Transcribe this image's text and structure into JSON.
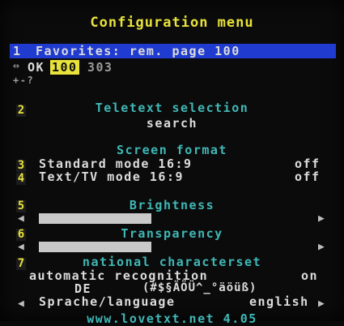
{
  "title": "Configuration menu",
  "favorites": {
    "number": "1",
    "label": "Favorites: rem. page 100",
    "nav": "⇔",
    "ok": "OK",
    "page_a": "100",
    "page_b": "303",
    "extra": "+-?"
  },
  "teletext": {
    "number": "2",
    "heading": "Teletext selection",
    "value": "search"
  },
  "screen_format": {
    "heading": "Screen format",
    "items": [
      {
        "number": "3",
        "label": "Standard mode 16:9",
        "value": "off"
      },
      {
        "number": "4",
        "label": "Text/TV mode 16:9",
        "value": "off"
      }
    ]
  },
  "brightness": {
    "number": "5",
    "heading": "Brightness",
    "level": 0.42
  },
  "transparency": {
    "number": "6",
    "heading": "Transparency",
    "level": 0.42
  },
  "charset": {
    "number": "7",
    "heading": "national characterset",
    "auto_label": "automatic recognition",
    "auto_value": "on",
    "country": "DE",
    "chars": "(#$§ÄÖÜ^_°äöüß)"
  },
  "language": {
    "label": "Sprache/language",
    "value": "english"
  },
  "footer": "www.lovetxt.net 4.05",
  "colors": {
    "yellow": "#e8e23a",
    "cyan": "#3fb8b6",
    "blue": "#1f3bd0",
    "white": "#dcdcdc"
  }
}
